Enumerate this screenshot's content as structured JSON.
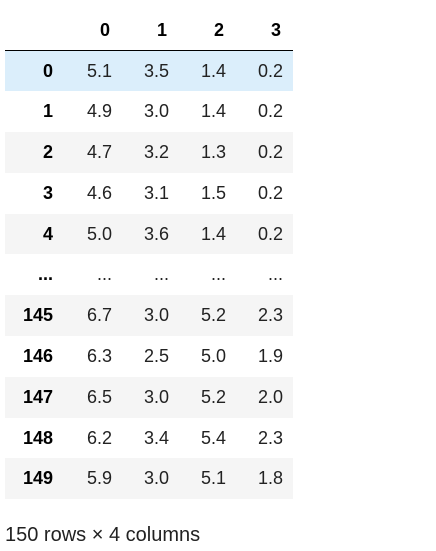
{
  "table": {
    "columns": [
      "",
      "0",
      "1",
      "2",
      "3"
    ],
    "rows": [
      {
        "index": "0",
        "cells": [
          "5.1",
          "3.5",
          "1.4",
          "0.2"
        ]
      },
      {
        "index": "1",
        "cells": [
          "4.9",
          "3.0",
          "1.4",
          "0.2"
        ]
      },
      {
        "index": "2",
        "cells": [
          "4.7",
          "3.2",
          "1.3",
          "0.2"
        ]
      },
      {
        "index": "3",
        "cells": [
          "4.6",
          "3.1",
          "1.5",
          "0.2"
        ]
      },
      {
        "index": "4",
        "cells": [
          "5.0",
          "3.6",
          "1.4",
          "0.2"
        ]
      },
      {
        "index": "...",
        "cells": [
          "...",
          "...",
          "...",
          "..."
        ]
      },
      {
        "index": "145",
        "cells": [
          "6.7",
          "3.0",
          "5.2",
          "2.3"
        ]
      },
      {
        "index": "146",
        "cells": [
          "6.3",
          "2.5",
          "5.0",
          "1.9"
        ]
      },
      {
        "index": "147",
        "cells": [
          "6.5",
          "3.0",
          "5.2",
          "2.0"
        ]
      },
      {
        "index": "148",
        "cells": [
          "6.2",
          "3.4",
          "5.4",
          "2.3"
        ]
      },
      {
        "index": "149",
        "cells": [
          "5.9",
          "3.0",
          "5.1",
          "1.8"
        ]
      }
    ]
  },
  "shape_note": "150 rows × 4 columns",
  "colors": {
    "hover_row": "#dbeefb",
    "striped_row": "#f5f5f5",
    "header_border": "#000000"
  }
}
